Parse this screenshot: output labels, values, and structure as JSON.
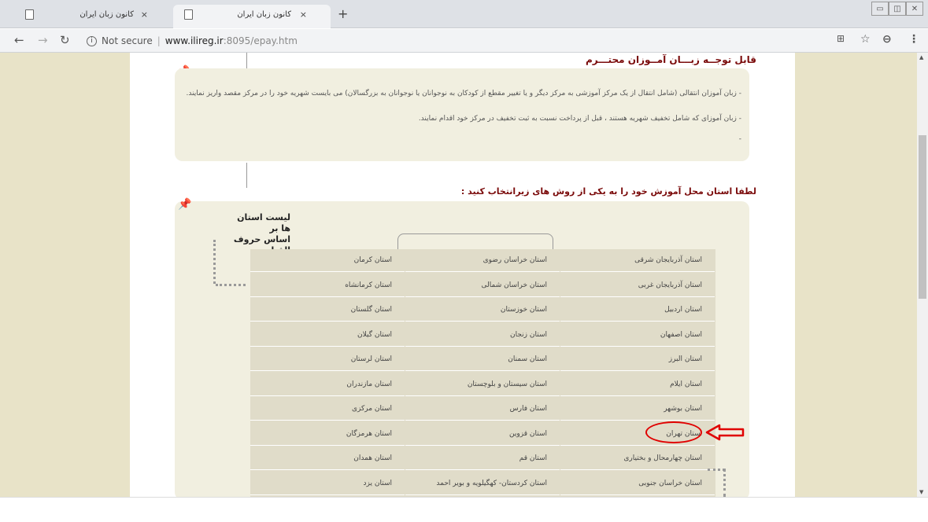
{
  "browser": {
    "tabs": [
      {
        "title": "کانون زبان ایران",
        "close": "×"
      },
      {
        "title": "کانون زبان ایران",
        "close": "×"
      }
    ],
    "new_tab": "+",
    "address": {
      "security": "Not secure",
      "domain": "www.ilireg.ir",
      "path": ":8095/epay.htm"
    },
    "nav_icons": [
      "back-icon",
      "forward-icon",
      "reload-icon"
    ],
    "right_icons": [
      "translate-icon",
      "star-icon",
      "account-icon",
      "menu-icon"
    ]
  },
  "page": {
    "notice_title": "قابل توجــه زبـــان آمــوزان محتـــرم",
    "notes": [
      "- زبان آموزان انتقالی (شامل انتقال از یک مرکز آموزشی به مرکز دیگر و یا تغییر مقطع از کودکان به نوجوانان یا نوجوانان به بزرگسالان) می بایست شهریه خود را در مرکز مقصد واریز نمایند.",
      "- زبان آموزای که شامل تخفیف شهریه هستند ، قبل از پرداخت نسبت به ثبت تخفیف در مرکز خود اقدام نمایند.",
      "-"
    ],
    "select_title": "لطفا استان محل آموزش خود را به یکی از روش های زیرانتخاب کنید :",
    "list_label_line1": "لیست استان ها بر",
    "list_label_line2": "اساس حروف الفبا",
    "provinces": {
      "col_right": [
        "استان آذربایجان شرقی",
        "استان آذربایجان غربی",
        "استان اردبیل",
        "استان اصفهان",
        "استان البرز",
        "استان ایلام",
        "استان بوشهر",
        "استان تهران",
        "استان چهارمحال و بختیاری",
        "استان خراسان جنوبی"
      ],
      "col_mid": [
        "استان خراسان رضوی",
        "استان خراسان شمالی",
        "استان خوزستان",
        "استان زنجان",
        "استان سمنان",
        "استان سیستان و بلوچستان",
        "استان فارس",
        "استان قزوین",
        "استان قم",
        "استان کردستان- کهگیلویه و بویر احمد"
      ],
      "col_left": [
        "استان کرمان",
        "استان کرمانشاه",
        "استان گلستان",
        "استان گیلان",
        "استان لرستان",
        "استان مازندران",
        "استان مرکزی",
        "استان هرمزگان",
        "استان همدان",
        "استان یزد"
      ]
    },
    "highlighted": "استان تهران",
    "colors": {
      "highlight": "#e00000",
      "title": "#7a0a0a",
      "background": "#e8e3c8"
    }
  }
}
